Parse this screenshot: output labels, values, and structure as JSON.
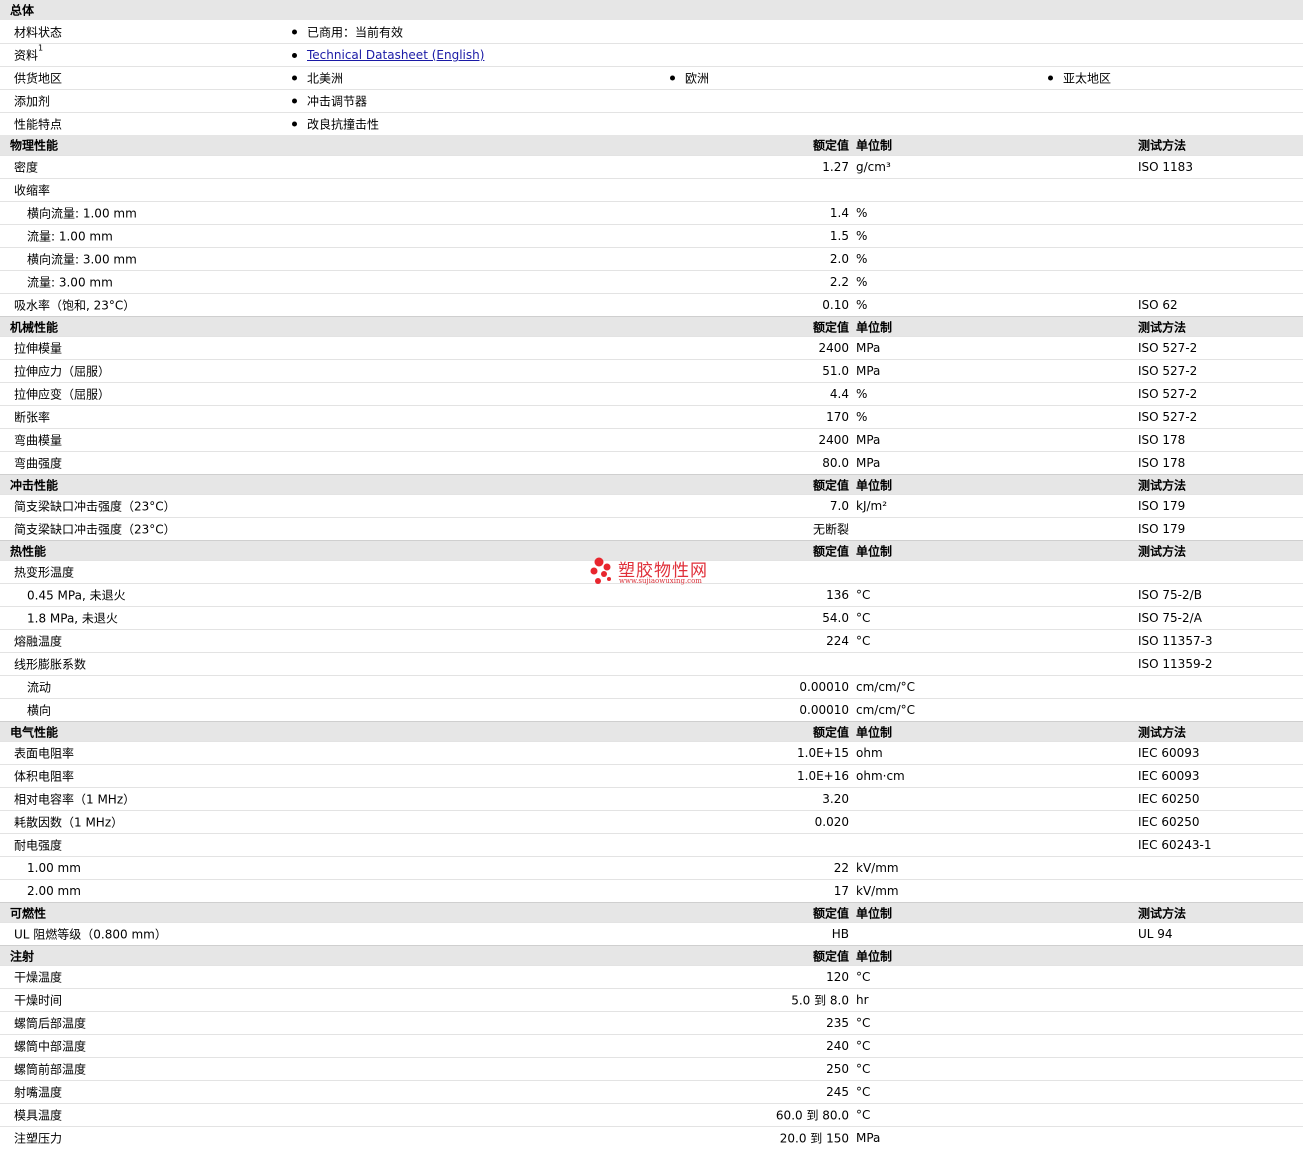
{
  "general": {
    "title": "总体",
    "rows": [
      {
        "label": "材料状态",
        "options": [
          "已商用：当前有效"
        ]
      },
      {
        "label": "资料",
        "sup": "1",
        "options": [
          "Technical Datasheet (English)"
        ],
        "link": true
      },
      {
        "label": "供货地区",
        "options": [
          "北美洲",
          "欧洲",
          "亚太地区"
        ]
      },
      {
        "label": "添加剂",
        "options": [
          "冲击调节器"
        ]
      },
      {
        "label": "性能特点",
        "options": [
          "改良抗撞击性"
        ]
      }
    ]
  },
  "headers": {
    "value": "额定值",
    "unit": "单位制",
    "test": "测试方法"
  },
  "sections": [
    {
      "title": "物理性能",
      "show_test": true,
      "rows": [
        {
          "name": "密度",
          "value": "1.27",
          "unit": "g/cm³",
          "test": "ISO 1183"
        },
        {
          "name": "收缩率",
          "value": "",
          "unit": "",
          "test": ""
        },
        {
          "name": "横向流量: 1.00 mm",
          "sub": true,
          "value": "1.4",
          "unit": "%",
          "test": ""
        },
        {
          "name": "流量: 1.00 mm",
          "sub": true,
          "value": "1.5",
          "unit": "%",
          "test": ""
        },
        {
          "name": "横向流量: 3.00 mm",
          "sub": true,
          "value": "2.0",
          "unit": "%",
          "test": ""
        },
        {
          "name": "流量: 3.00 mm",
          "sub": true,
          "value": "2.2",
          "unit": "%",
          "test": ""
        },
        {
          "name": "吸水率（饱和, 23°C）",
          "value": "0.10",
          "unit": "%",
          "test": "ISO 62"
        }
      ]
    },
    {
      "title": "机械性能",
      "show_test": true,
      "rows": [
        {
          "name": "拉伸模量",
          "value": "2400",
          "unit": "MPa",
          "test": "ISO 527-2"
        },
        {
          "name": "拉伸应力（屈服）",
          "value": "51.0",
          "unit": "MPa",
          "test": "ISO 527-2"
        },
        {
          "name": "拉伸应变（屈服）",
          "value": "4.4",
          "unit": "%",
          "test": "ISO 527-2"
        },
        {
          "name": "断张率",
          "value": "170",
          "unit": "%",
          "test": "ISO 527-2"
        },
        {
          "name": "弯曲模量",
          "value": "2400",
          "unit": "MPa",
          "test": "ISO 178"
        },
        {
          "name": "弯曲强度",
          "value": "80.0",
          "unit": "MPa",
          "test": "ISO 178"
        }
      ]
    },
    {
      "title": "冲击性能",
      "show_test": true,
      "rows": [
        {
          "name": "简支梁缺口冲击强度（23°C）",
          "value": "7.0",
          "unit": "kJ/m²",
          "test": "ISO 179"
        },
        {
          "name": "简支梁缺口冲击强度（23°C）",
          "value": "无断裂",
          "unit": "",
          "test": "ISO 179"
        }
      ]
    },
    {
      "title": "热性能",
      "show_test": true,
      "rows": [
        {
          "name": "热变形温度",
          "value": "",
          "unit": "",
          "test": ""
        },
        {
          "name": "0.45 MPa, 未退火",
          "sub": true,
          "value": "136",
          "unit": "°C",
          "test": "ISO 75-2/B"
        },
        {
          "name": "1.8 MPa, 未退火",
          "sub": true,
          "value": "54.0",
          "unit": "°C",
          "test": "ISO 75-2/A"
        },
        {
          "name": "熔融温度",
          "value": "224",
          "unit": "°C",
          "test": "ISO 11357-3"
        },
        {
          "name": "线形膨胀系数",
          "value": "",
          "unit": "",
          "test": "ISO 11359-2"
        },
        {
          "name": "流动",
          "sub": true,
          "value": "0.00010",
          "unit": "cm/cm/°C",
          "test": ""
        },
        {
          "name": "横向",
          "sub": true,
          "value": "0.00010",
          "unit": "cm/cm/°C",
          "test": ""
        }
      ]
    },
    {
      "title": "电气性能",
      "show_test": true,
      "rows": [
        {
          "name": "表面电阻率",
          "value": "1.0E+15",
          "unit": "ohm",
          "test": "IEC 60093"
        },
        {
          "name": "体积电阻率",
          "value": "1.0E+16",
          "unit": "ohm·cm",
          "test": "IEC 60093"
        },
        {
          "name": "相对电容率（1 MHz）",
          "value": "3.20",
          "unit": "",
          "test": "IEC 60250"
        },
        {
          "name": "耗散因数（1 MHz）",
          "value": "0.020",
          "unit": "",
          "test": "IEC 60250"
        },
        {
          "name": "耐电强度",
          "value": "",
          "unit": "",
          "test": "IEC 60243-1"
        },
        {
          "name": "1.00 mm",
          "sub": true,
          "value": "22",
          "unit": "kV/mm",
          "test": ""
        },
        {
          "name": "2.00 mm",
          "sub": true,
          "value": "17",
          "unit": "kV/mm",
          "test": ""
        }
      ]
    },
    {
      "title": "可燃性",
      "show_test": true,
      "rows": [
        {
          "name": "UL 阻燃等级（0.800 mm）",
          "value": "HB",
          "unit": "",
          "test": "UL 94"
        }
      ]
    },
    {
      "title": "注射",
      "show_test": false,
      "rows": [
        {
          "name": "干燥温度",
          "value": "120",
          "unit": "°C",
          "test": ""
        },
        {
          "name": "干燥时间",
          "value": "5.0 到  8.0",
          "unit": "hr",
          "test": ""
        },
        {
          "name": "螺筒后部温度",
          "value": "235",
          "unit": "°C",
          "test": ""
        },
        {
          "name": "螺筒中部温度",
          "value": "240",
          "unit": "°C",
          "test": ""
        },
        {
          "name": "螺筒前部温度",
          "value": "250",
          "unit": "°C",
          "test": ""
        },
        {
          "name": "射嘴温度",
          "value": "245",
          "unit": "°C",
          "test": ""
        },
        {
          "name": "模具温度",
          "value": "60.0 到  80.0",
          "unit": "°C",
          "test": ""
        },
        {
          "name": "注塑压力",
          "value": "20.0 到  150",
          "unit": "MPa",
          "test": ""
        }
      ]
    }
  ],
  "watermark": {
    "text": "塑胶物性网",
    "url": "www.sujiaowuxing.com"
  }
}
